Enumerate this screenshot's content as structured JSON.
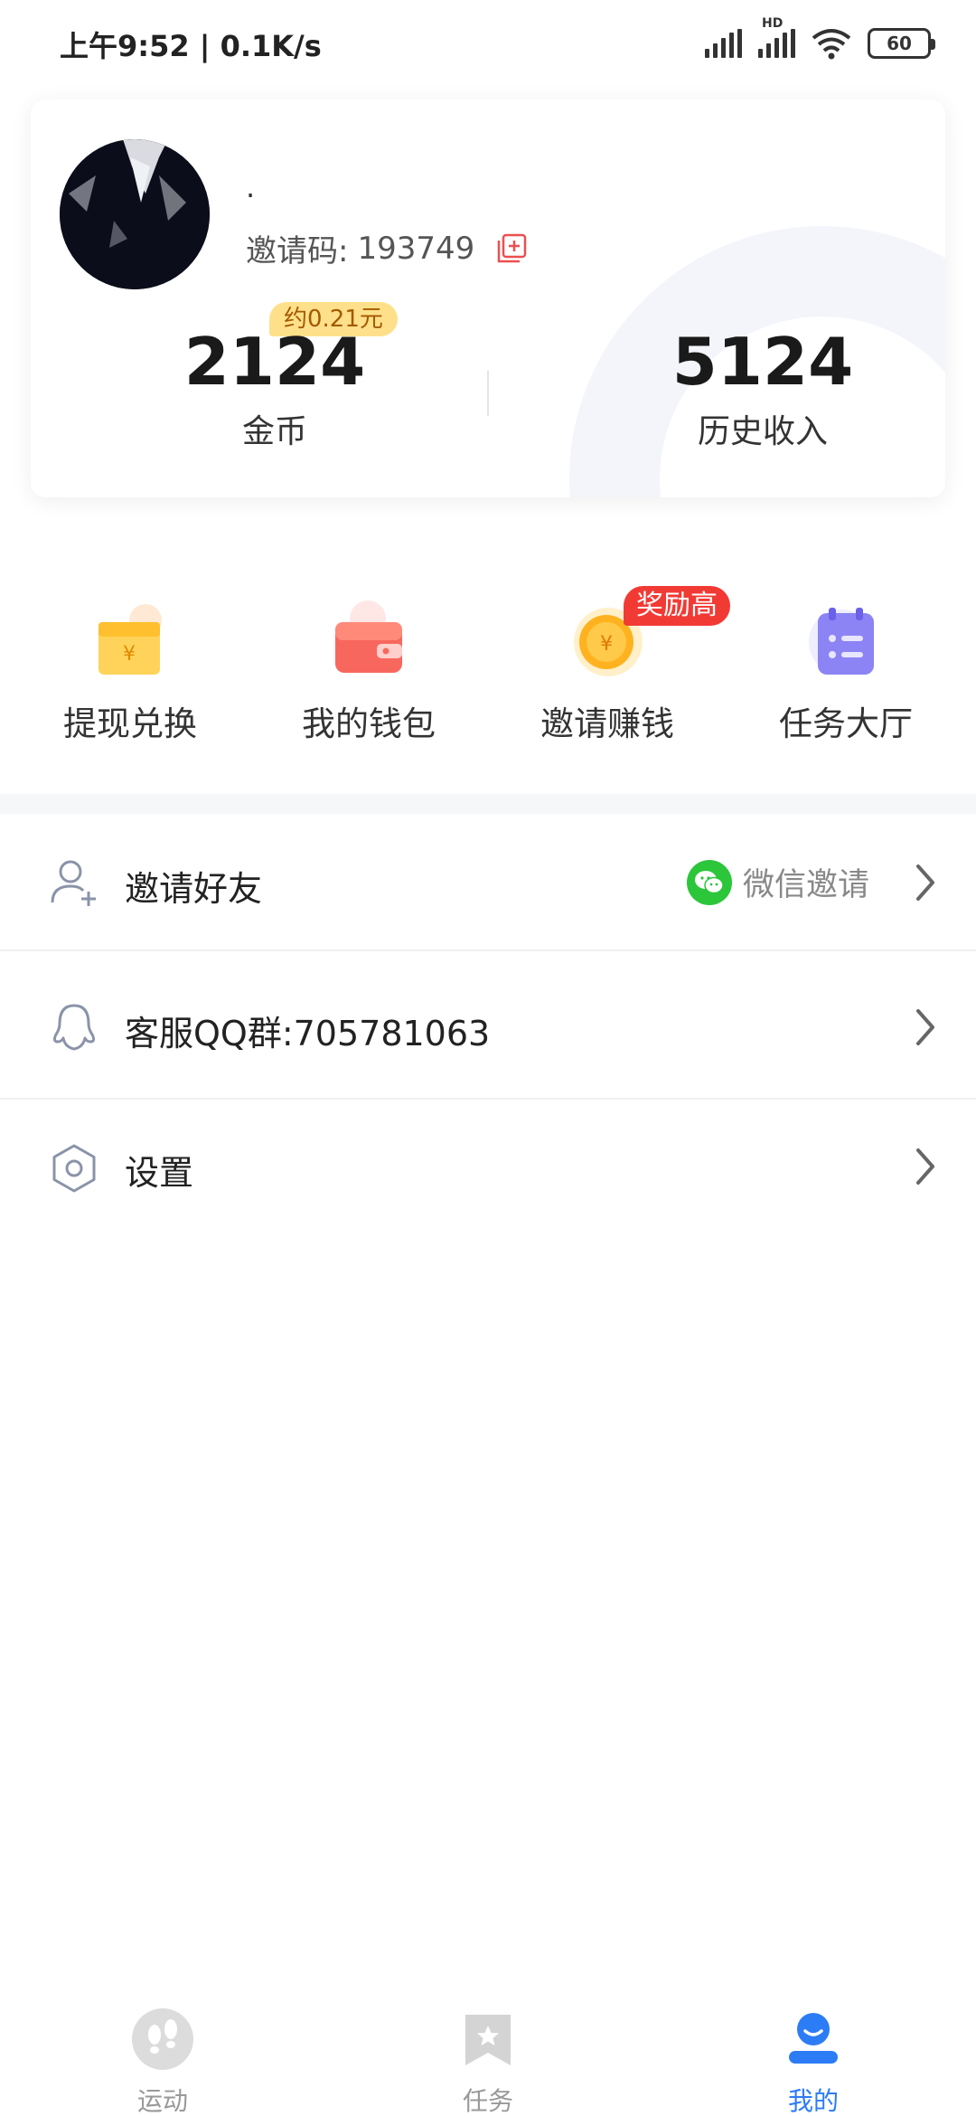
{
  "status_bar": {
    "time": "上午9:52 | 0.1K/s",
    "hd_label": "HD",
    "battery": "60"
  },
  "profile": {
    "nickname": ".",
    "invite_prefix": "邀请码:",
    "invite_code": "193749",
    "approx_value": "约0.21元",
    "coins_value": "2124",
    "coins_label": "金币",
    "history_value": "5124",
    "history_label": "历史收入"
  },
  "quick_actions": [
    {
      "label": "提现兑换",
      "icon": "gift-box-yuan-icon"
    },
    {
      "label": "我的钱包",
      "icon": "wallet-icon"
    },
    {
      "label": "邀请赚钱",
      "icon": "gold-coin-icon",
      "badge": "奖励高"
    },
    {
      "label": "任务大厅",
      "icon": "task-clipboard-icon"
    }
  ],
  "list": {
    "invite_friends": "邀请好友",
    "wechat_invite": "微信邀请",
    "customer_service": "客服QQ群:705781063",
    "settings": "设置"
  },
  "bottom_nav": [
    {
      "label": "运动",
      "icon": "footprints-icon",
      "active": false
    },
    {
      "label": "任务",
      "icon": "bookmark-star-icon",
      "active": false
    },
    {
      "label": "我的",
      "icon": "user-icon",
      "active": true
    }
  ],
  "colors": {
    "accent_blue": "#2c7cf5",
    "badge_red": "#f23a35",
    "badge_yellow": "#ffe08a",
    "wechat_green": "#2bc63a"
  }
}
